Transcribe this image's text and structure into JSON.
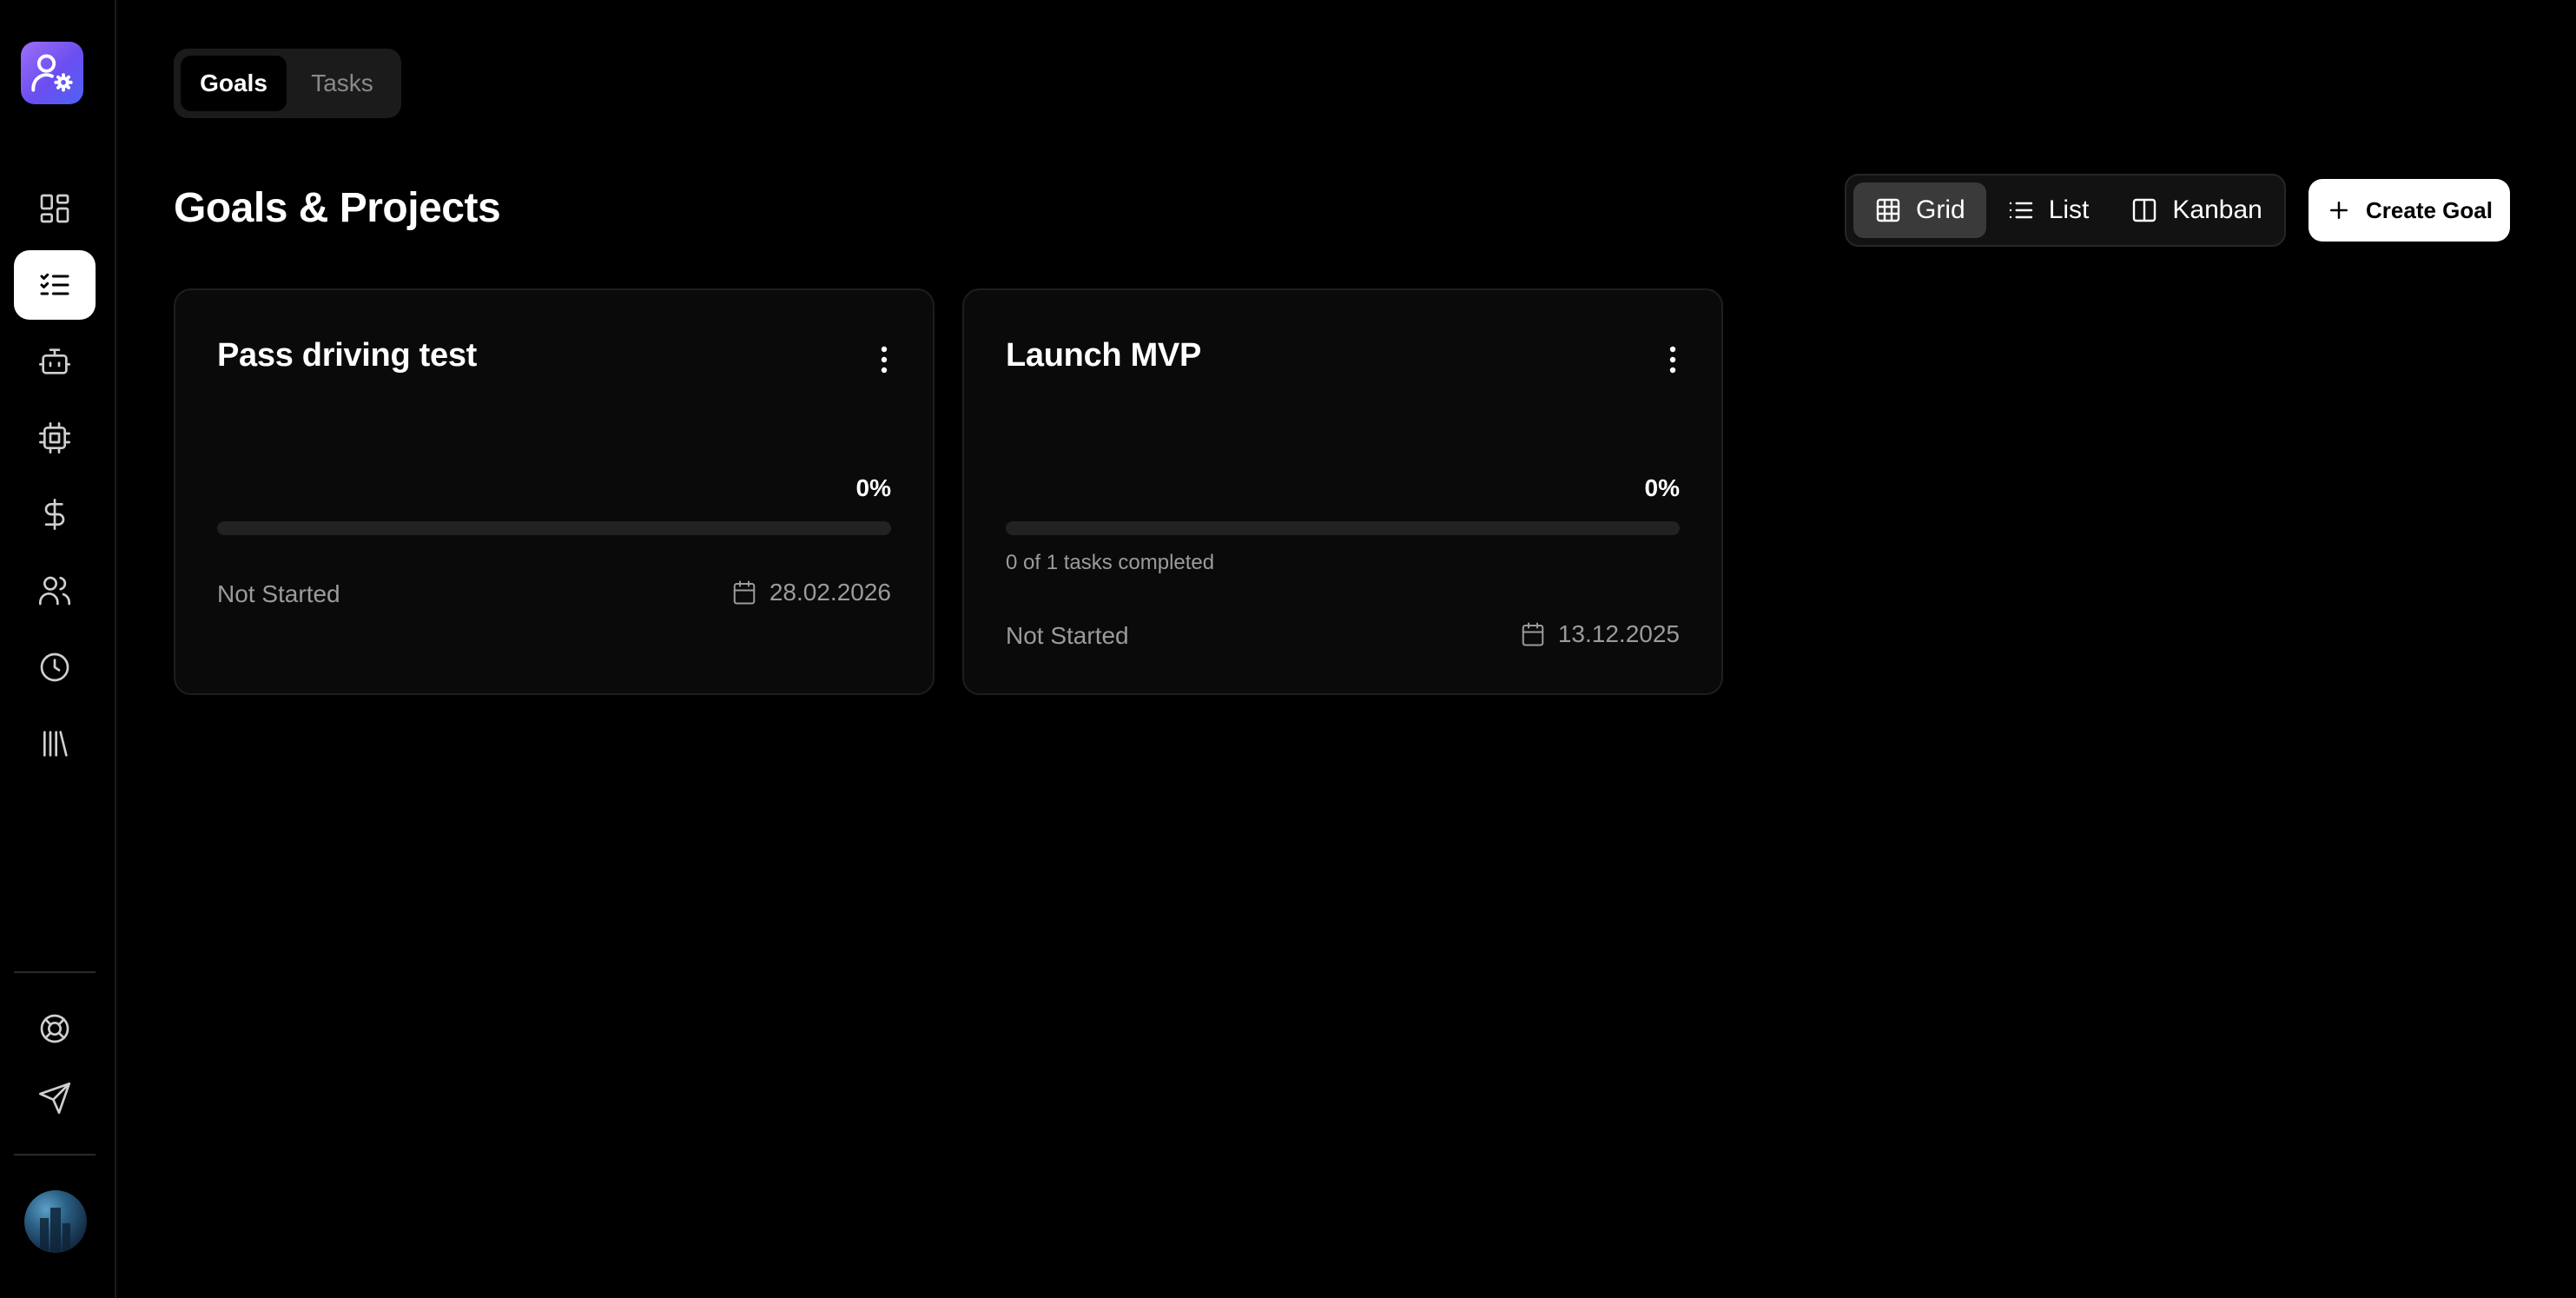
{
  "top_tabs": [
    {
      "label": "Goals",
      "active": true
    },
    {
      "label": "Tasks",
      "active": false
    }
  ],
  "page_title": "Goals & Projects",
  "view_switcher": [
    {
      "label": "Grid",
      "icon": "grid-icon",
      "active": true
    },
    {
      "label": "List",
      "icon": "list-icon",
      "active": false
    },
    {
      "label": "Kanban",
      "icon": "kanban-icon",
      "active": false
    }
  ],
  "create_button": {
    "label": "Create Goal",
    "icon": "plus-icon"
  },
  "sidebar": {
    "logo_icon": "user-settings-icon",
    "items": [
      {
        "icon": "dashboard-icon",
        "active": false
      },
      {
        "icon": "checklist-icon",
        "active": true
      },
      {
        "icon": "bot-icon",
        "active": false
      },
      {
        "icon": "cpu-icon",
        "active": false
      },
      {
        "icon": "dollar-icon",
        "active": false
      },
      {
        "icon": "users-icon",
        "active": false
      },
      {
        "icon": "clock-icon",
        "active": false
      },
      {
        "icon": "library-icon",
        "active": false
      }
    ],
    "bottom_items": [
      {
        "icon": "lifebuoy-icon"
      },
      {
        "icon": "send-icon"
      }
    ]
  },
  "goals": [
    {
      "title": "Pass driving test",
      "progress_label": "0%",
      "progress": 0,
      "tasks_text": "",
      "status": "Not Started",
      "date": "28.02.2026"
    },
    {
      "title": "Launch MVP",
      "progress_label": "0%",
      "progress": 0,
      "tasks_text": "0 of 1 tasks completed",
      "status": "Not Started",
      "date": "13.12.2025"
    }
  ],
  "colors": {
    "background": "#000000",
    "card": "#0a0a0a",
    "accent_gradient_start": "#9d6ff8",
    "accent_gradient_end": "#4e63f5",
    "muted_text": "#9b9b9b"
  }
}
